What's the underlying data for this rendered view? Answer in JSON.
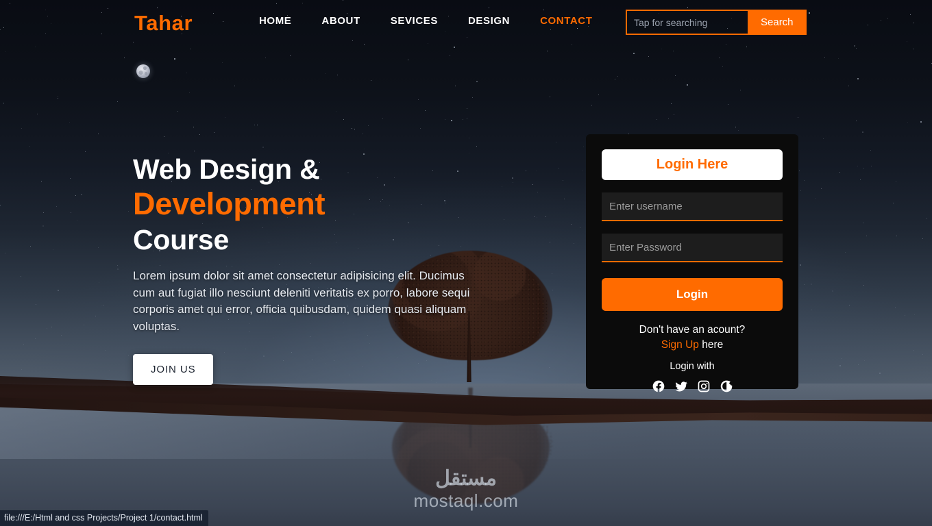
{
  "header": {
    "logo": "Tahar",
    "nav": [
      {
        "label": "HOME",
        "active": false
      },
      {
        "label": "ABOUT",
        "active": false
      },
      {
        "label": "SEVICES",
        "active": false
      },
      {
        "label": "DESIGN",
        "active": false
      },
      {
        "label": "CONTACT",
        "active": true
      }
    ],
    "search": {
      "placeholder": "Tap for searching",
      "value": "",
      "button_label": "Search"
    }
  },
  "hero": {
    "line1": "Web Design &",
    "line2": "Development",
    "line3": "Course",
    "paragraph": "Lorem ipsum dolor sit amet consectetur adipisicing elit. Ducimus cum aut fugiat illo nesciunt deleniti veritatis ex porro, labore sequi corporis amet qui error, officia quibusdam, quidem quasi aliquam voluptas.",
    "cta_label": "JOIN US"
  },
  "login": {
    "title": "Login Here",
    "username_placeholder": "Enter username",
    "username_value": "",
    "password_placeholder": "Enter Password",
    "password_value": "",
    "submit_label": "Login",
    "signup_question": "Don't have an acount?",
    "signup_link": "Sign Up",
    "signup_suffix": " here",
    "login_with": "Login with",
    "socials": [
      {
        "name": "facebook-icon"
      },
      {
        "name": "twitter-icon"
      },
      {
        "name": "instagram-icon"
      },
      {
        "name": "google-icon"
      }
    ]
  },
  "watermark": {
    "arabic": "مستقل",
    "latin": "mostaql.com"
  },
  "statusbar": {
    "url": "file:///E:/Html and css Projects/Project 1/contact.html"
  },
  "colors": {
    "accent": "#ff6b00",
    "panel_bg": "#0b0b0b",
    "sky_top": "#090c13",
    "water": "#4a5565",
    "ground": "#2b1b16"
  }
}
